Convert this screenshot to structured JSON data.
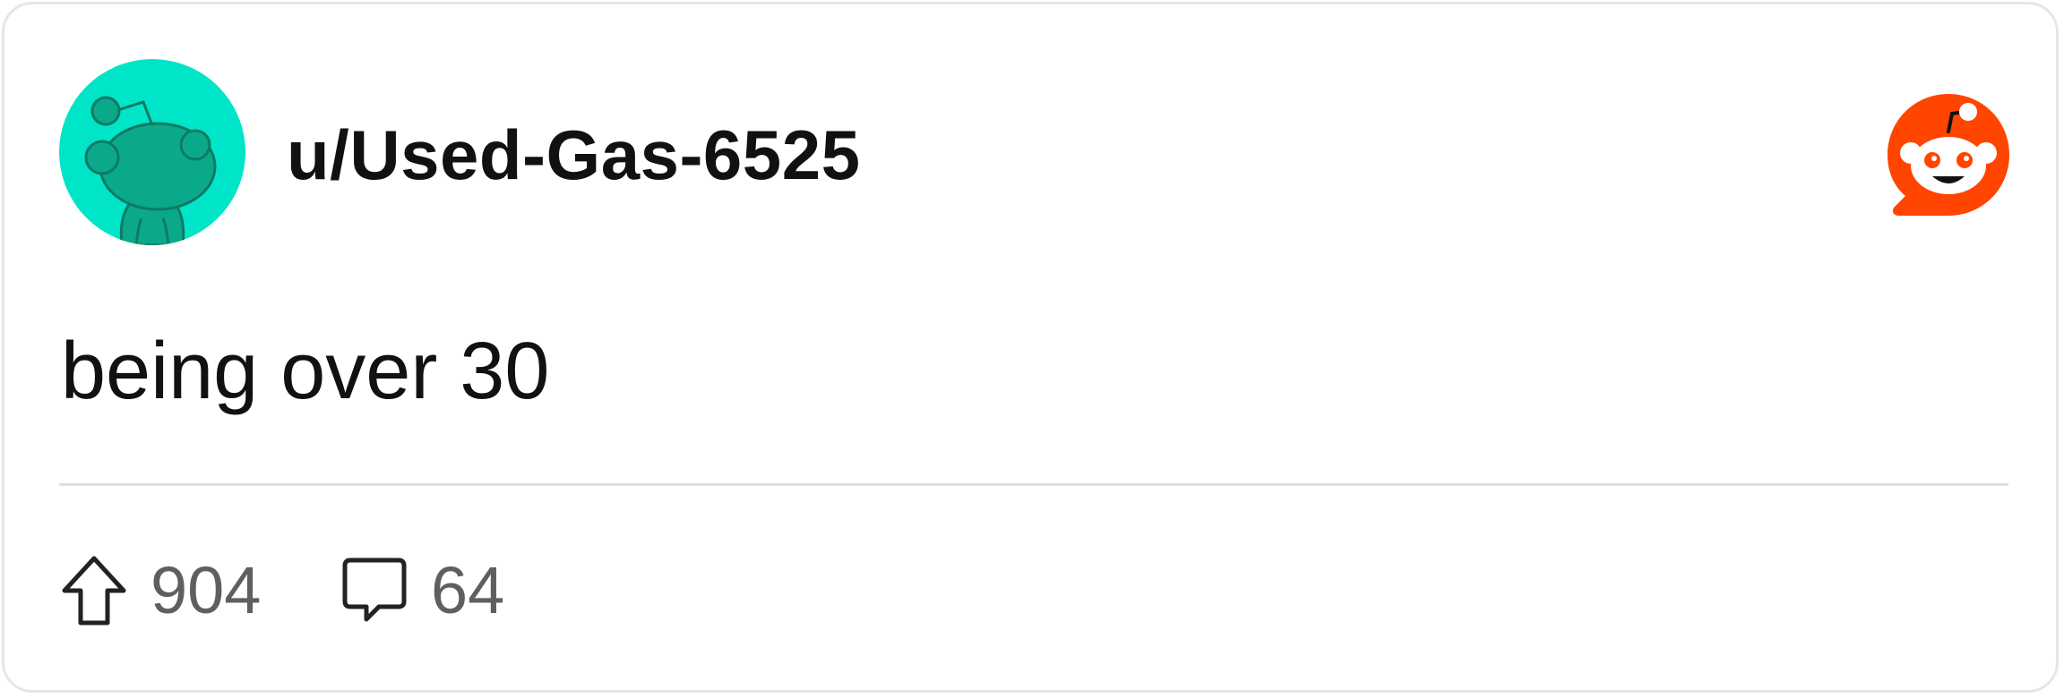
{
  "post": {
    "username": "u/Used-Gas-6525",
    "title": "being over 30",
    "upvotes": "904",
    "comments": "64"
  },
  "icons": {
    "avatar": "snoo-avatar-icon",
    "brand": "reddit-logo-icon",
    "upvote": "upvote-arrow-icon",
    "comment": "comment-bubble-icon"
  },
  "colors": {
    "avatar_bg": "#00e5c8",
    "avatar_snoo": "#0aa98a",
    "brand": "#ff4500",
    "text": "#111111",
    "muted": "#5f5f5f",
    "divider": "#dedede"
  }
}
